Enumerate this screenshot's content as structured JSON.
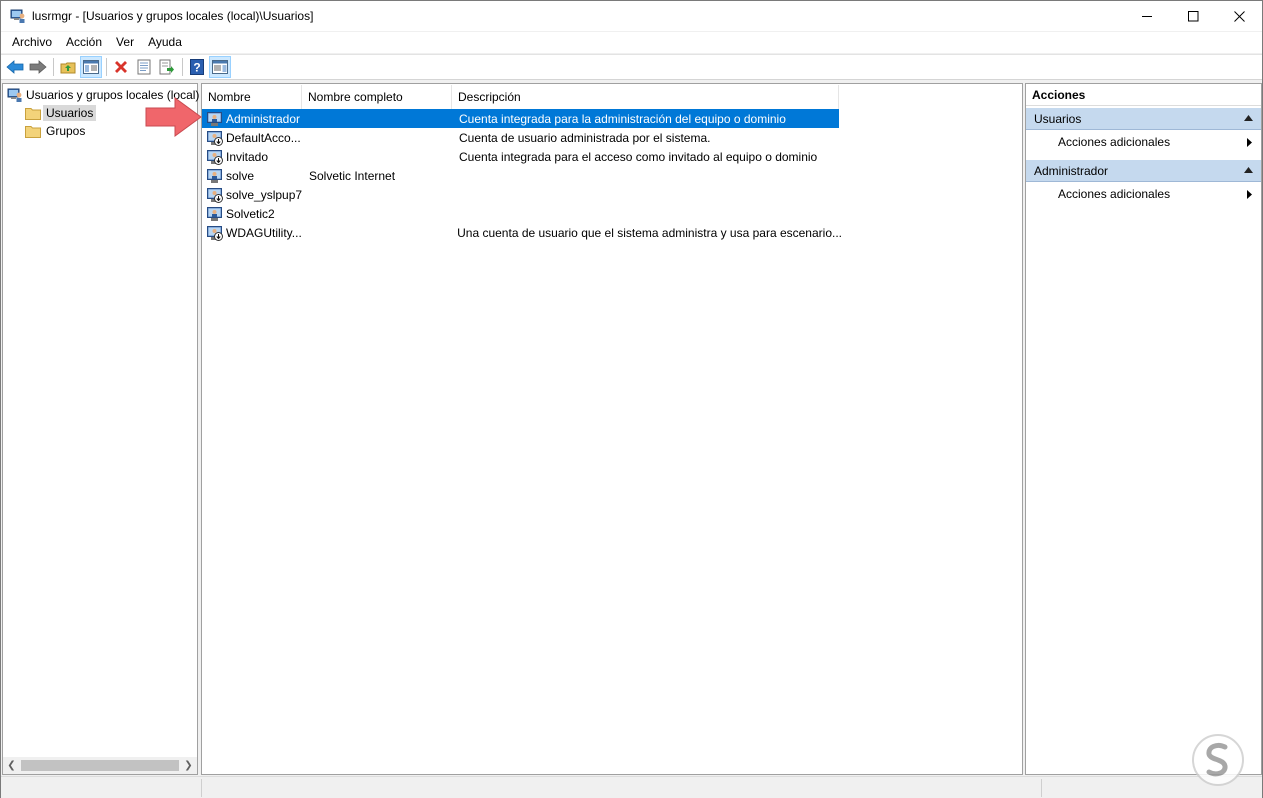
{
  "window": {
    "title": "lusrmgr - [Usuarios y grupos locales (local)\\Usuarios]",
    "minimize_icon": "minimize-icon",
    "maximize_icon": "maximize-icon",
    "close_icon": "close-icon"
  },
  "menu": [
    "Archivo",
    "Acción",
    "Ver",
    "Ayuda"
  ],
  "toolbar": {
    "buttons": [
      "back-arrow-icon",
      "forward-arrow-icon",
      "up-folder-icon",
      "show-hide-tree-icon",
      "delete-icon",
      "properties-icon",
      "export-list-icon",
      "help-icon",
      "show-hide-action-pane-icon"
    ]
  },
  "tree": {
    "root": "Usuarios y grupos locales (local)",
    "children": [
      "Usuarios",
      "Grupos"
    ],
    "selected": "Usuarios"
  },
  "list": {
    "columns": [
      "Nombre",
      "Nombre completo",
      "Descripción"
    ],
    "rows": [
      {
        "name": "Administrador",
        "full_name": "",
        "description": "Cuenta integrada para la administración del equipo o dominio",
        "selected": true
      },
      {
        "name": "DefaultAcco...",
        "full_name": "",
        "description": "Cuenta de usuario administrada por el sistema."
      },
      {
        "name": "Invitado",
        "full_name": "",
        "description": "Cuenta integrada para el acceso como invitado al equipo o dominio"
      },
      {
        "name": "solve",
        "full_name": "Solvetic Internet",
        "description": ""
      },
      {
        "name": "solve_yslpup7",
        "full_name": "",
        "description": ""
      },
      {
        "name": "Solvetic2",
        "full_name": "",
        "description": ""
      },
      {
        "name": "WDAGUtility...",
        "full_name": "",
        "description": "Una cuenta de usuario que el sistema administra y usa para escenario..."
      }
    ]
  },
  "actions": {
    "title": "Acciones",
    "sections": [
      {
        "header": "Usuarios",
        "items": [
          "Acciones adicionales"
        ]
      },
      {
        "header": "Administrador",
        "items": [
          "Acciones adicionales"
        ]
      }
    ]
  },
  "colors": {
    "selection": "#0078d7",
    "section_header": "#c5d9ee",
    "arrow": "#f0666b"
  }
}
